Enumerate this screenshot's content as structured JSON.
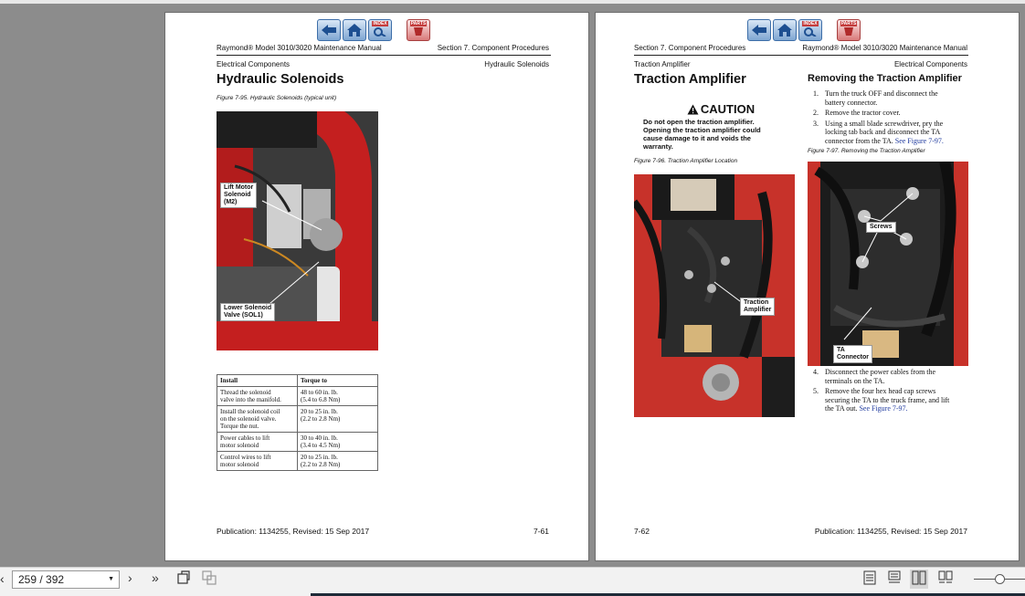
{
  "left_page": {
    "header_left": "Raymond® Model 3010/3020 Maintenance Manual",
    "header_right": "Section 7.  Component Procedures",
    "subheader_left": "Electrical Components",
    "subheader_right": "Hydraulic Solenoids",
    "title": "Hydraulic Solenoids",
    "figure_caption": "Figure 7-95.    Hydraulic Solenoids (typical unit)",
    "callout_lift": [
      "Lift Motor",
      "Solenoid",
      "(M2)"
    ],
    "callout_lower": [
      "Lower Solenoid",
      "Valve (SOL1)"
    ],
    "table": {
      "headers": [
        "Install",
        "Torque to"
      ],
      "rows": [
        [
          [
            "Thread the solenoid",
            "valve into the manifold."
          ],
          [
            "48 to 60 in. lb.",
            "(5.4 to 6.8 Nm)"
          ]
        ],
        [
          [
            "Install the solenoid coil",
            "on the solenoid valve.",
            "Torque the nut."
          ],
          [
            "20 to 25 in. lb.",
            "(2.2 to 2.8 Nm)"
          ]
        ],
        [
          [
            "Power cables to lift",
            "motor solenoid"
          ],
          [
            "30 to 40 in. lb.",
            "(3.4 to 4.5 Nm)"
          ]
        ],
        [
          [
            "Control wires to lift",
            "motor solenoid"
          ],
          [
            "20 to 25 in. lb.",
            "(2.2 to 2.8 Nm)"
          ]
        ]
      ]
    },
    "footer_left": "Publication: 1134255, Revised: 15 Sep 2017",
    "footer_right": "7-61"
  },
  "right_page": {
    "header_left": "Section 7.  Component Procedures",
    "header_right": "Raymond® Model 3010/3020 Maintenance Manual",
    "subheader_left": "Traction Amplifier",
    "subheader_right": "Electrical Components",
    "title": "Traction Amplifier",
    "caution_title": "CAUTION",
    "caution_text": [
      "Do not open the traction amplifier.",
      "Opening the traction amplifier could",
      "cause damage to it and voids the",
      "warranty."
    ],
    "figure96_caption": "Figure 7-96.    Traction Amplifier Location",
    "callout_ta": [
      "Traction",
      "Amplifier"
    ],
    "removing_title": "Removing the Traction Amplifier",
    "steps_top": [
      {
        "num": "1.",
        "lines": [
          "Turn the truck OFF and disconnect the",
          "battery connector."
        ]
      },
      {
        "num": "2.",
        "lines": [
          "Remove the tractor cover."
        ]
      },
      {
        "num": "3.",
        "lines": [
          "Using a small blade screwdriver, pry the",
          "locking tab back and disconnect the TA",
          "connector from the TA."
        ],
        "link": "See Figure 7-97."
      }
    ],
    "figure97_caption": "Figure 7-97.    Removing the Traction Amplifier",
    "callout_screws": "Screws",
    "callout_connector": [
      "TA",
      "Connector"
    ],
    "steps_bottom": [
      {
        "num": "4.",
        "lines": [
          "Disconnect the power cables from the",
          "terminals on the TA."
        ]
      },
      {
        "num": "5.",
        "lines": [
          "Remove the four hex head cap screws",
          "securing the TA to the truck frame, and lift",
          "the TA out."
        ],
        "link": "See Figure 7-97."
      }
    ],
    "footer_left": "7-62",
    "footer_right": "Publication: 1134255, Revised: 15 Sep 2017"
  },
  "nav_icons": [
    "back-arrow-icon",
    "home-icon",
    "index-icon",
    "parts-icon"
  ],
  "nav_labels": {
    "index": "INDEX",
    "parts": "PARTS"
  },
  "toolbar": {
    "page_indicator": "259 / 392"
  },
  "colors": {
    "link": "#1f3a9e",
    "photo_red": "#c41f1f",
    "nav_blue": "#3d6ea8"
  }
}
